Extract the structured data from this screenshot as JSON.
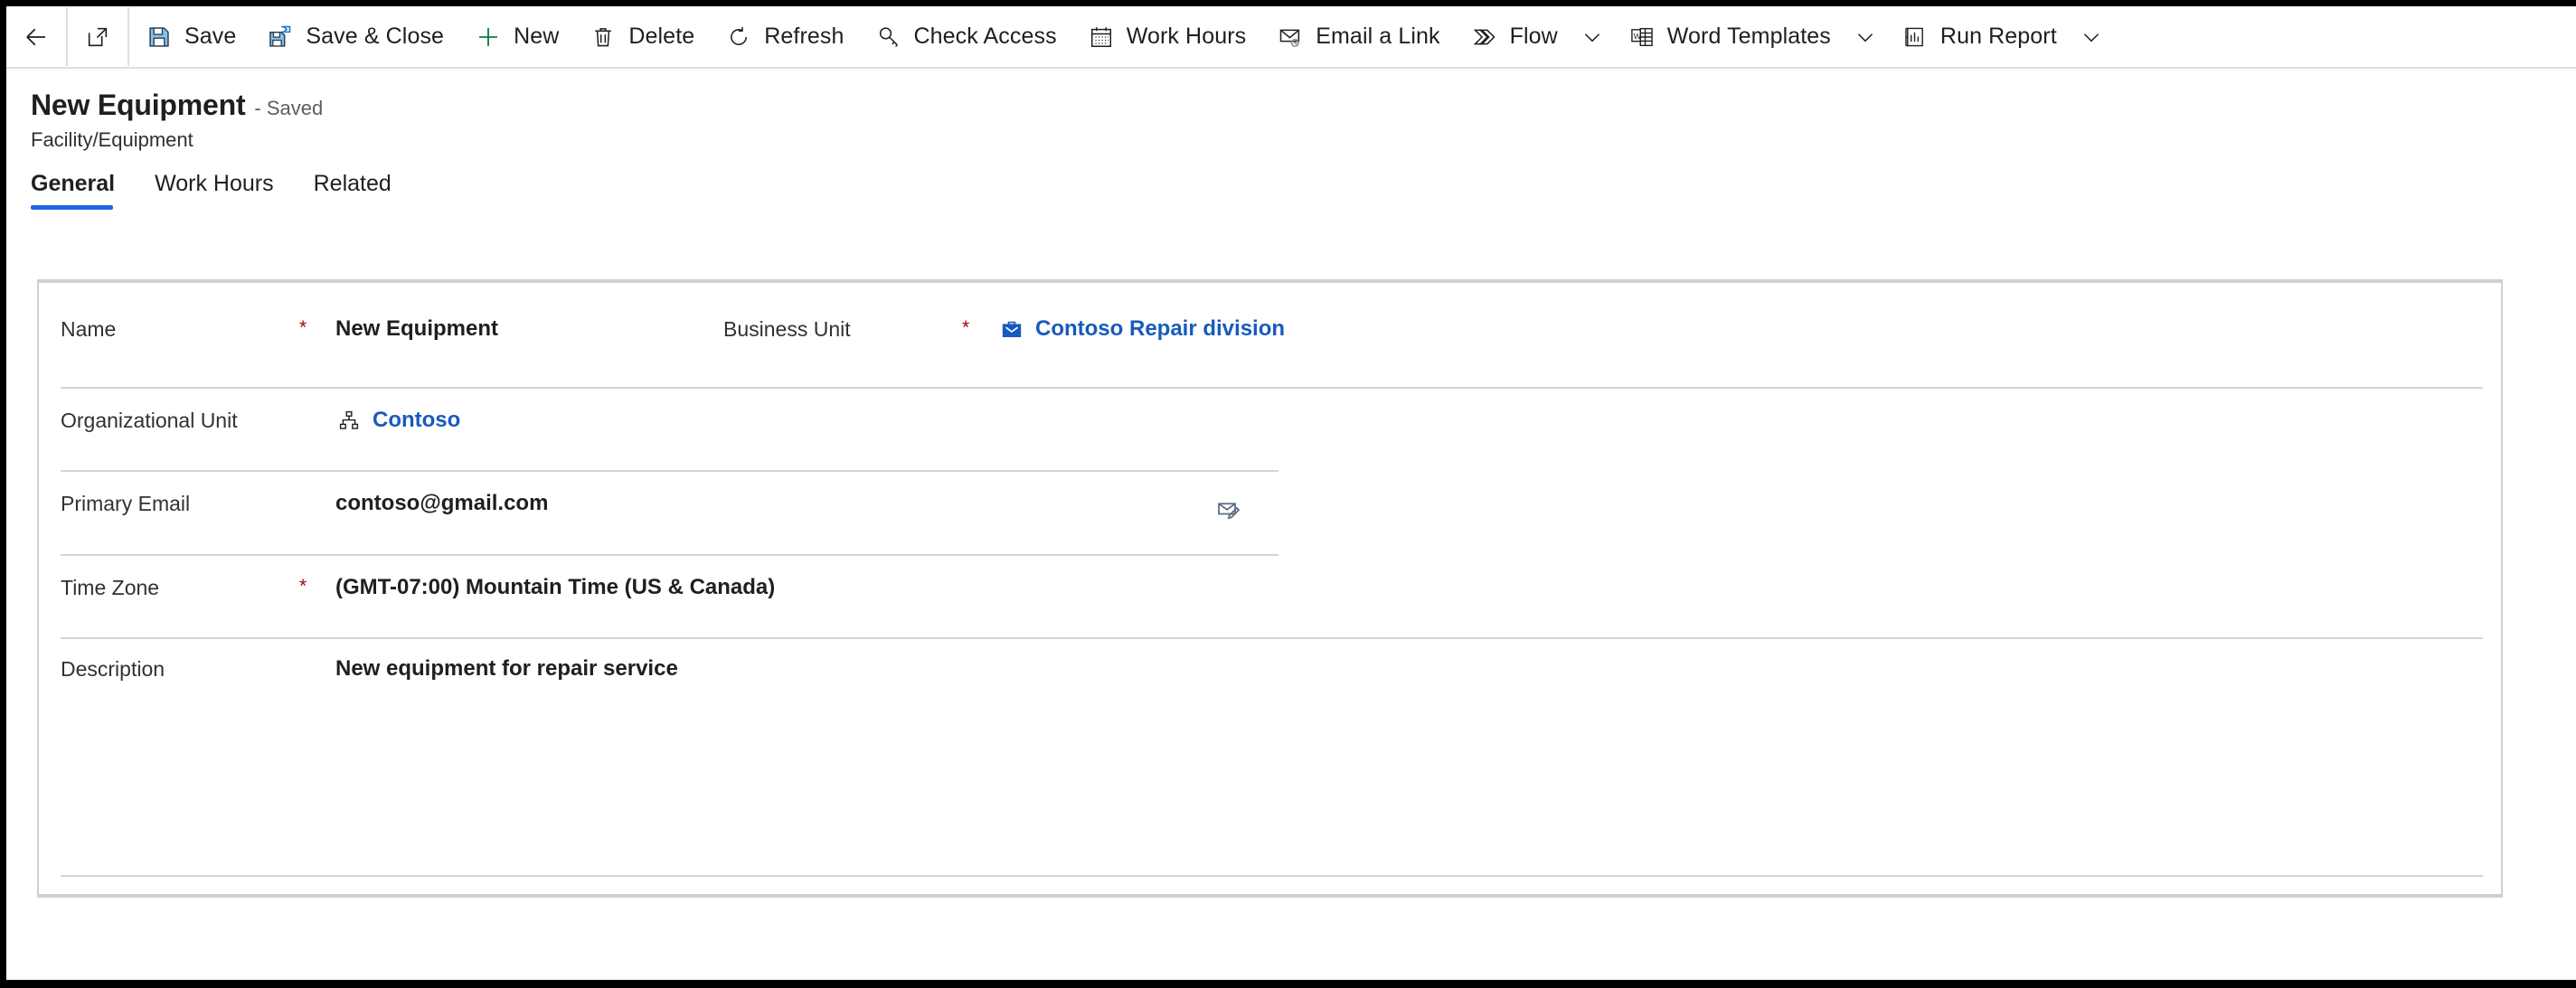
{
  "commandbar": {
    "back_label": "Back",
    "popout_label": "Open in new window",
    "items": [
      {
        "label": "Save",
        "icon": "save-icon"
      },
      {
        "label": "Save & Close",
        "icon": "save-and-close-icon"
      },
      {
        "label": "New",
        "icon": "plus-icon"
      },
      {
        "label": "Delete",
        "icon": "trash-icon"
      },
      {
        "label": "Refresh",
        "icon": "refresh-icon"
      },
      {
        "label": "Check Access",
        "icon": "key-icon"
      },
      {
        "label": "Work Hours",
        "icon": "calendar-icon"
      },
      {
        "label": "Email a Link",
        "icon": "email-link-icon"
      },
      {
        "label": "Flow",
        "icon": "flow-icon",
        "chevron": true
      },
      {
        "label": "Word Templates",
        "icon": "word-icon",
        "chevron": true
      },
      {
        "label": "Run Report",
        "icon": "report-icon",
        "chevron": true
      }
    ]
  },
  "header": {
    "title": "New Equipment",
    "state": "- Saved",
    "entity": "Facility/Equipment"
  },
  "tabs": [
    {
      "label": "General",
      "active": true
    },
    {
      "label": "Work Hours",
      "active": false
    },
    {
      "label": "Related",
      "active": false
    }
  ],
  "form": {
    "name": {
      "label": "Name",
      "required": "*",
      "value": "New Equipment"
    },
    "organizational_unit": {
      "label": "Organizational Unit",
      "required": "",
      "value": "Contoso",
      "icon": "org-chart-icon"
    },
    "primary_email": {
      "label": "Primary Email",
      "required": "",
      "value": "contoso@gmail.com",
      "action_icon": "email-compose-icon"
    },
    "time_zone": {
      "label": "Time Zone",
      "required": "*",
      "value": "(GMT-07:00) Mountain Time (US & Canada)"
    },
    "description": {
      "label": "Description",
      "required": "",
      "value": "New equipment for repair service"
    },
    "business_unit": {
      "label": "Business Unit",
      "required": "*",
      "value": "Contoso Repair division",
      "icon": "briefcase-icon"
    }
  },
  "colors": {
    "accent": "#2266e3",
    "link": "#185abd",
    "required": "#a80000",
    "divider": "#d6d4d2",
    "card_border": "#d2d0ce"
  }
}
